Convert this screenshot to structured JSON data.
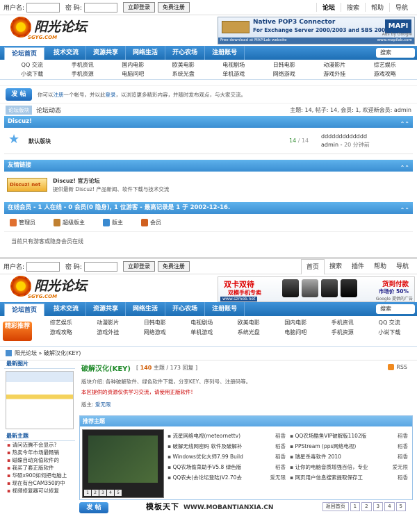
{
  "screen1": {
    "topbar": {
      "user_label": "用户名:",
      "pass_label": "密 码:",
      "login_btn": "立即登录",
      "register_btn": "免费注册",
      "links": [
        "论坛",
        "搜索",
        "帮助",
        "导航"
      ]
    },
    "logo": {
      "title": "阳光论坛",
      "sub": "SGYG.COM"
    },
    "ad": {
      "line1": "Native POP3 Connector",
      "line2": "For Exchange Server 2000/2003 and SBS 2000/2003",
      "brand": "MAPI lab",
      "footer_left": "Free download at MAPILab website",
      "footer_right": "www.mapilab.com",
      "ads_by": "Ads by Google"
    },
    "nav": {
      "items": [
        "论坛首页",
        "技术交流",
        "资源共享",
        "网络生活",
        "开心农场",
        "注册账号"
      ],
      "search": "搜索"
    },
    "cats": [
      "QQ 交流",
      "手机资讯",
      "国内电影",
      "欧美电影",
      "电视剧场",
      "日韩电影",
      "动漫影片",
      "综艺娱乐",
      "小说下载",
      "手机资源",
      "电脑问吧",
      "系统光盘",
      "单机游戏",
      "网络游戏",
      "游戏外挂",
      "游戏攻略"
    ],
    "post_btn": "发 帖",
    "welcome_prefix": "你可以",
    "welcome_register": "注册",
    "welcome_mid": "一个帐号，并以此",
    "welcome_login": "登录",
    "welcome_suffix": "，以浏览更多精彩内容，并随时发布观点，与大家交流。",
    "tabs": [
      "论坛版块",
      "论坛动态"
    ],
    "stats": "主题: 14, 帖子: 14, 会员: 1, 欢迎新会员: admin",
    "section_discuz": "Discuz!",
    "forum": {
      "name": "默认版块",
      "topics": "14",
      "posts": "14",
      "last_title": "ddddddddddddd",
      "last_user": "admin",
      "last_time": "20 分钟前"
    },
    "section_links": "友情链接",
    "link": {
      "logo": "Discuz! net",
      "name": "Discuz! 官方论坛",
      "desc": "提供最新 Discuz! 产品新闻、软件下载与技术交流"
    },
    "online_header": "在线会员 - 1 人在线 - 0 会员(0 隐身), 1 位游客 - 最高记录是 1 于 2002-12-16.",
    "legend": [
      "管理员",
      "超级版主",
      "版主",
      "会员"
    ],
    "legend_colors": [
      "#e07030",
      "#c08030",
      "#3a8ad0",
      "#d06020"
    ],
    "online_none": "当前只有游客或隐身会员在线"
  },
  "screen2": {
    "topbar": {
      "user_label": "用户名:",
      "pass_label": "密 码:",
      "login_btn": "立即登录",
      "register_btn": "免费注册",
      "links": [
        "首页",
        "搜索",
        "插件",
        "帮助",
        "导航"
      ]
    },
    "ad": {
      "line1": "双卡双待",
      "line2": "双模手机专卖",
      "line3": "货到付款",
      "line4": "市场价 50%",
      "url": "www.szmob.net",
      "ads_by": "Google 提供的广告"
    },
    "cat_logo": "精彩推荐",
    "cats": [
      "综艺娱乐",
      "动漫影片",
      "日韩电影",
      "电视剧场",
      "欧美电影",
      "国内电影",
      "手机资讯",
      "QQ 交流",
      "游戏攻略",
      "游戏外挂",
      "网络游戏",
      "单机游戏",
      "系统光盘",
      "电脑问吧",
      "手机资源",
      "小说下载"
    ],
    "breadcrumb": "阳光论坛 » 破解汉化(KEY)",
    "side": {
      "img_title": "最新图片",
      "topics_title": "最新主题",
      "topics": [
        "请问迈腾不会显示?",
        "热卖今年市场最畅销",
        "磁碟自动充值软件的",
        "我买了套正版软件",
        "华硕x900如何把电脑上",
        "现在有台CAM350的中",
        "视频修复器可以修复"
      ]
    },
    "forum": {
      "title": "破解汉化(KEY)",
      "topics": "140",
      "topics_label": "主题",
      "posts": "173",
      "posts_label": "回复",
      "rss": "RSS",
      "intro": "版块介绍: 各种破解软件、绿色软件下载，分享KEY、序列号、注册码等。",
      "notice": "本区提供的资源仅供学习交流，请使用正版软件!",
      "mod_label": "版主:",
      "mod": "爱无限"
    },
    "rec_title": "推荐主题",
    "thread_col1": [
      {
        "t": "流星网络电视(meteornettv)",
        "a": "稻香"
      },
      {
        "t": "破解无线网密码 软件及破解补",
        "a": "稻香"
      },
      {
        "t": "Windows优化大师7.99 Build",
        "a": "稻香"
      },
      {
        "t": "QQ农场偷菜助手V5.8 绿色版",
        "a": "稻香"
      },
      {
        "t": "QQ农夫(去论坛登陆)V2.70去",
        "a": "爱无限"
      }
    ],
    "thread_col2": [
      {
        "t": "QQ农场酷鱼VIP破解版1102版",
        "a": "稻香"
      },
      {
        "t": "PPStream (pps网络电视)",
        "a": "稻香"
      },
      {
        "t": "瑞星杀毒软件 2010",
        "a": "稻香"
      },
      {
        "t": "让你的电脑音质增强百倍，专业",
        "a": "爱无限"
      },
      {
        "t": "网页用户信息搜索提取保存工",
        "a": "稻香"
      }
    ],
    "shot_pages": [
      "1",
      "2",
      "3",
      "4",
      "5"
    ],
    "post_btn": "发 帖",
    "watermark": "模板天下",
    "watermark_url": "WWW.MOBANTIANXIA.CN",
    "pager": [
      "返回首页",
      "1",
      "2",
      "3",
      "4",
      "5"
    ]
  }
}
